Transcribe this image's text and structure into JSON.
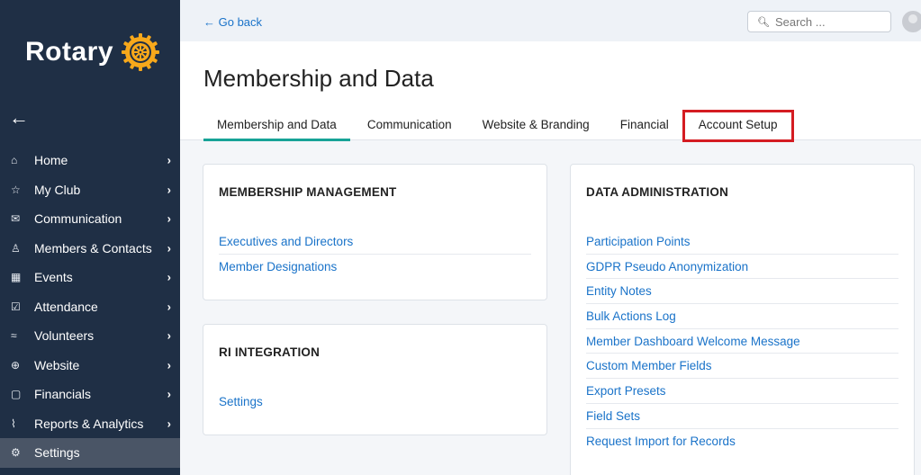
{
  "sidebar": {
    "logo_text": "Rotary",
    "items": [
      {
        "icon": "⌂",
        "label": "Home"
      },
      {
        "icon": "☆",
        "label": "My Club"
      },
      {
        "icon": "✉",
        "label": "Communication"
      },
      {
        "icon": "♙",
        "label": "Members & Contacts"
      },
      {
        "icon": "▦",
        "label": "Events"
      },
      {
        "icon": "☑",
        "label": "Attendance"
      },
      {
        "icon": "≈",
        "label": "Volunteers"
      },
      {
        "icon": "⊕",
        "label": "Website"
      },
      {
        "icon": "▢",
        "label": "Financials"
      },
      {
        "icon": "⌇",
        "label": "Reports & Analytics"
      },
      {
        "icon": "⚙",
        "label": "Settings"
      }
    ]
  },
  "topbar": {
    "go_back": "← Go back",
    "search_placeholder": "Search ..."
  },
  "page": {
    "title": "Membership and Data",
    "tabs": [
      "Membership and Data",
      "Communication",
      "Website & Branding",
      "Financial",
      "Account Setup"
    ]
  },
  "cards": {
    "membership": {
      "title": "MEMBERSHIP MANAGEMENT",
      "links": [
        "Executives and Directors",
        "Member Designations"
      ]
    },
    "ri": {
      "title": "RI INTEGRATION",
      "links": [
        "Settings"
      ]
    },
    "data_admin": {
      "title": "DATA ADMINISTRATION",
      "links": [
        "Participation Points",
        "GDPR Pseudo Anonymization",
        "Entity Notes",
        "Bulk Actions Log",
        "Member Dashboard Welcome Message",
        "Custom Member Fields",
        "Export Presets",
        "Field Sets",
        "Request Import for Records"
      ]
    }
  },
  "colors": {
    "sidebar_bg": "#1f2f45",
    "link": "#1a73c9",
    "tab_active": "#17a397",
    "highlight": "#d41c22",
    "rotary_gold": "#f7a81b"
  }
}
